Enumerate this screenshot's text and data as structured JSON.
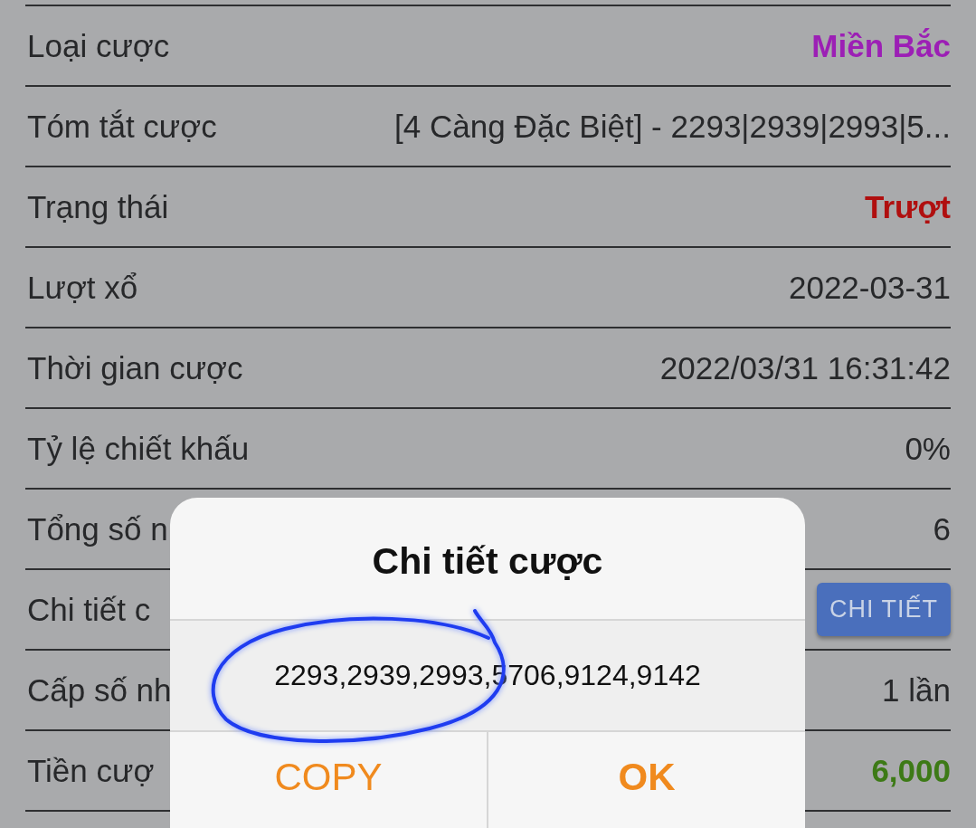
{
  "rows": [
    {
      "label": "Loại cược",
      "kind": "emphasis",
      "value": "Miền Bắc",
      "color": "#9c1fb5"
    },
    {
      "label": "Tóm tắt cược",
      "kind": "text",
      "value": "[4 Càng Đặc Biệt] - 2293|2939|2993|5..."
    },
    {
      "label": "Trạng thái",
      "kind": "emphasis",
      "value": "Trượt",
      "color": "#b00f0f"
    },
    {
      "label": "Lượt xổ",
      "kind": "text",
      "value": "2022-03-31"
    },
    {
      "label": "Thời gian cược",
      "kind": "text",
      "value": "2022/03/31 16:31:42"
    },
    {
      "label": "Tỷ lệ chiết khấu",
      "kind": "text",
      "value": "0%"
    },
    {
      "label": "Tổng số n",
      "kind": "text",
      "value": "6"
    },
    {
      "label": "Chi tiết c",
      "kind": "button",
      "value": "CHI TIẾT"
    },
    {
      "label": "Cấp số nh",
      "kind": "text",
      "value": "1 lần"
    },
    {
      "label": "Tiền cượ",
      "kind": "emphasis",
      "value": "6,000",
      "color": "#3d7a16"
    }
  ],
  "dialog": {
    "title": "Chi tiết cược",
    "message": "2293,2939,2993,5706,9124,9142",
    "buttons": [
      {
        "label": "COPY",
        "kind": "plain"
      },
      {
        "label": "OK",
        "kind": "primary"
      }
    ]
  }
}
